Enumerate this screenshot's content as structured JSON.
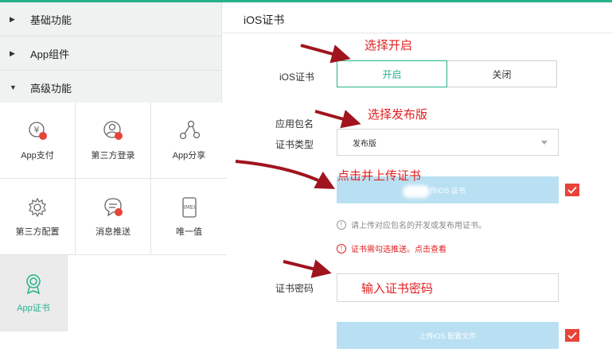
{
  "sidebar": {
    "nav": [
      {
        "label": "基础功能",
        "marker": "▶"
      },
      {
        "label": "App组件",
        "marker": "▶"
      },
      {
        "label": "高级功能",
        "marker": "▼"
      }
    ],
    "features": [
      {
        "label": "App支付",
        "icon": "payment-icon"
      },
      {
        "label": "第三方登录",
        "icon": "third-party-login-icon"
      },
      {
        "label": "App分享",
        "icon": "share-icon"
      },
      {
        "label": "第三方配置",
        "icon": "settings-gear-icon"
      },
      {
        "label": "消息推送",
        "icon": "push-message-icon"
      },
      {
        "label": "唯一值",
        "icon": "imei-icon"
      },
      {
        "label": "App证书",
        "icon": "certificate-badge-icon"
      }
    ],
    "active_feature": "App证书"
  },
  "main": {
    "title": "iOS证书",
    "ios_cert_label": "iOS证书",
    "toggle": {
      "on": "开启",
      "off": "关闭",
      "selected": "开启"
    },
    "package_label": "应用包名",
    "cert_type_label": "证书类型",
    "cert_type_value": "发布版",
    "upload_cert_button": "传iOS 证书",
    "hint_text": "请上传对应包名的开发或发布用证书。",
    "warn_text": "证书需勾选推送。点击查看",
    "password_label": "证书密码",
    "password_value": "输入证书密码",
    "upload_profile_button": "上传iOS 配置文件"
  },
  "annotations": {
    "toggle_note": "选择开启",
    "type_note": "选择发布版",
    "upload_note": "点击并上传证书"
  },
  "colors": {
    "accent": "#26b18c",
    "annotation": "#e02020",
    "upload_bg": "#b9e0f2",
    "arrow": "#a0141e"
  }
}
